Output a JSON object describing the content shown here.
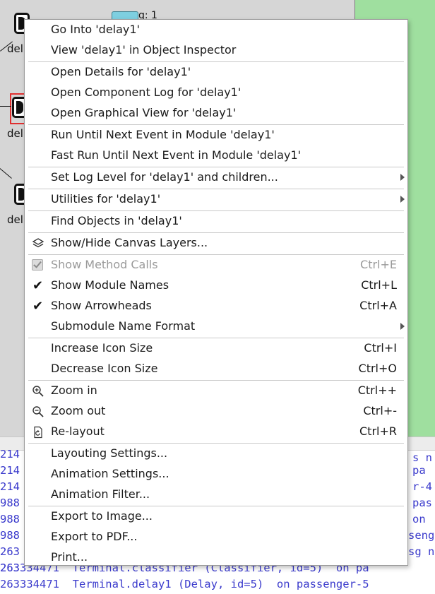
{
  "canvas": {
    "modules": [
      "del",
      "del",
      "del"
    ],
    "queue_label": "q: 1"
  },
  "log": {
    "lines": [
      "214",
      "214",
      "214",
      "988",
      "988",
      "988",
      "263",
      "263",
      "263334471  Terminal.classifier (Classifier, id=5)  on pa",
      "263334471  Terminal.delay1 (Delay, id=5)  on passenger-5"
    ],
    "right_fragments": [
      "s n",
      "pa",
      "r-4",
      "pas",
      "on",
      "senge",
      "sg n"
    ]
  },
  "menu": {
    "items": [
      {
        "label": "Go Into 'delay1'"
      },
      {
        "label": "View 'delay1' in Object Inspector"
      },
      {
        "label": "Open Details for 'delay1'"
      },
      {
        "label": "Open Component Log for 'delay1'"
      },
      {
        "label": "Open Graphical View for 'delay1'"
      },
      {
        "label": "Run Until Next Event in Module 'delay1'"
      },
      {
        "label": "Fast Run Until Next Event in Module 'delay1'"
      },
      {
        "label": "Set Log Level for 'delay1' and children..."
      },
      {
        "label": "Utilities for 'delay1'"
      },
      {
        "label": "Find Objects in 'delay1'"
      },
      {
        "label": "Show/Hide Canvas Layers...",
        "icon": "layers-icon"
      },
      {
        "label": "Show Method Calls",
        "shortcut": "Ctrl+E",
        "checked": true,
        "disabled": true
      },
      {
        "label": "Show Module Names",
        "shortcut": "Ctrl+L",
        "checked": true
      },
      {
        "label": "Show Arrowheads",
        "shortcut": "Ctrl+A",
        "checked": true
      },
      {
        "label": "Submodule Name Format"
      },
      {
        "label": "Increase Icon Size",
        "shortcut": "Ctrl+I"
      },
      {
        "label": "Decrease Icon Size",
        "shortcut": "Ctrl+O"
      },
      {
        "label": "Zoom in",
        "shortcut": "Ctrl++",
        "icon": "zoom-in-icon"
      },
      {
        "label": "Zoom out",
        "shortcut": "Ctrl+-",
        "icon": "zoom-out-icon"
      },
      {
        "label": "Re-layout",
        "shortcut": "Ctrl+R",
        "icon": "relayout-icon"
      },
      {
        "label": "Layouting Settings..."
      },
      {
        "label": "Animation Settings..."
      },
      {
        "label": "Animation Filter..."
      },
      {
        "label": "Export to Image..."
      },
      {
        "label": "Export to PDF..."
      },
      {
        "label": "Print..."
      }
    ]
  },
  "colors": {
    "canvas_green": "#9fdf9f",
    "canvas_gray": "#d6d6d6",
    "log_text": "#3a3acc",
    "selection_red": "#e03030"
  }
}
